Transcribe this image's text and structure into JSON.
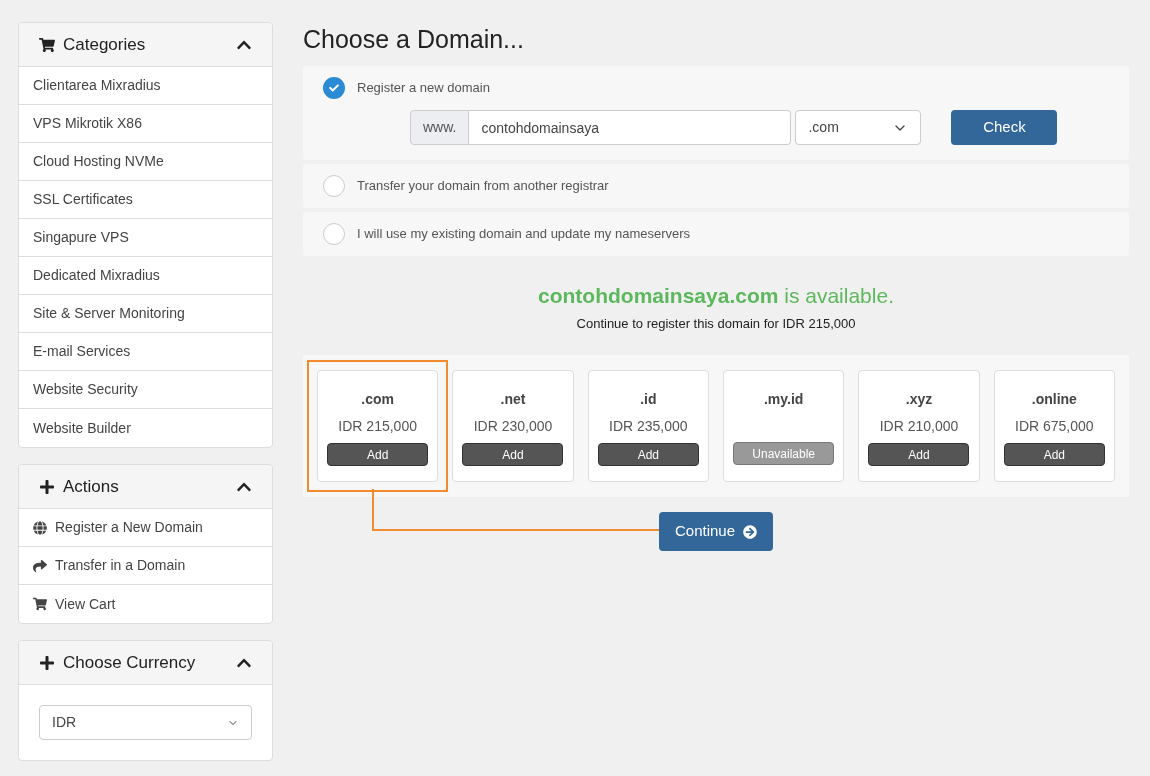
{
  "sidebar": {
    "panels": [
      {
        "title": "Categories",
        "expanded": true,
        "items": [
          {
            "label": "Clientarea Mixradius"
          },
          {
            "label": "VPS Mikrotik X86"
          },
          {
            "label": "Cloud Hosting NVMe"
          },
          {
            "label": "SSL Certificates"
          },
          {
            "label": "Singapure VPS"
          },
          {
            "label": "Dedicated Mixradius"
          },
          {
            "label": "Site & Server Monitoring"
          },
          {
            "label": "E-mail Services"
          },
          {
            "label": "Website Security"
          },
          {
            "label": "Website Builder"
          }
        ]
      },
      {
        "title": "Actions",
        "expanded": true,
        "items": [
          {
            "label": "Register a New Domain"
          },
          {
            "label": "Transfer in a Domain"
          },
          {
            "label": "View Cart"
          }
        ]
      },
      {
        "title": "Choose Currency",
        "expanded": true,
        "select": {
          "value": "IDR"
        }
      }
    ]
  },
  "main": {
    "title": "Choose a Domain...",
    "options": [
      {
        "label": "Register a new domain",
        "selected": true,
        "form": {
          "prefix": "www.",
          "value": "contohdomainsaya",
          "tld": ".com",
          "button": "Check"
        }
      },
      {
        "label": "Transfer your domain from another registrar",
        "selected": false
      },
      {
        "label": "I will use my existing domain and update my nameservers",
        "selected": false
      }
    ],
    "result": {
      "domain": "contohdomainsaya.com",
      "status": "is available.",
      "note": "Continue to register this domain for IDR 215,000"
    },
    "tlds": [
      {
        "name": ".com",
        "price": "IDR 215,000",
        "button": "Add",
        "available": true,
        "highlighted": true
      },
      {
        "name": ".net",
        "price": "IDR 230,000",
        "button": "Add",
        "available": true,
        "highlighted": false
      },
      {
        "name": ".id",
        "price": "IDR 235,000",
        "button": "Add",
        "available": true,
        "highlighted": false
      },
      {
        "name": ".my.id",
        "button": "Unavailable",
        "available": false,
        "highlighted": false
      },
      {
        "name": ".xyz",
        "price": "IDR 210,000",
        "button": "Add",
        "available": true,
        "highlighted": false
      },
      {
        "name": ".online",
        "price": "IDR 675,000",
        "button": "Add",
        "available": true,
        "highlighted": false
      }
    ],
    "continue": "Continue"
  }
}
